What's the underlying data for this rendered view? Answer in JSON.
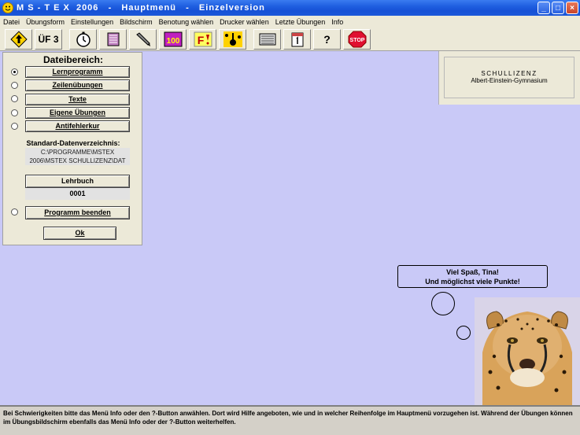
{
  "window": {
    "title": "M S - T E X  2006   -   Hauptmenü   -   Einzelversion",
    "minimize": "_",
    "maximize": "□",
    "close": "×"
  },
  "menu": [
    "Datei",
    "Übungsform",
    "Einstellungen",
    "Bildschirm",
    "Benotung wählen",
    "Drucker wählen",
    "Letzte Übungen",
    "Info"
  ],
  "toolbar": {
    "uf3_label": "ÜF 3",
    "help_label": "?",
    "stop_label": "STOP",
    "counter_label": "100",
    "f_label": "F",
    "icons": [
      "arrow-up-sign-icon",
      "uf3-button",
      "stopwatch-icon",
      "dice-icon",
      "pen-icon",
      "counter-100-icon",
      "f-alert-icon",
      "music-icon",
      "keyboard-icon",
      "calendar-icon",
      "help-icon",
      "stop-icon"
    ]
  },
  "panel": {
    "title": "Dateibereich:",
    "buttons": [
      "Lernprogramm",
      "Zeilenübungen",
      "Texte",
      "Eigene Übungen",
      "Antifehlerkur"
    ],
    "path_label": "Standard-Datenverzeichnis:",
    "path_line1": "C:\\PROGRAMME\\MSTEX",
    "path_line2": "2006\\MSTEX SCHULLIZENZ\\DAT",
    "lehrbuch_label": "Lehrbuch",
    "lehrbuch_value": "0001",
    "quit_label": "Programm beenden",
    "ok_label": "Ok"
  },
  "license": {
    "line1": "SCHULLIZENZ",
    "line2": "Albert-Einstein-Gymnasium"
  },
  "bubble": {
    "line1": "Viel Spaß, Tina!",
    "line2": "Und möglichst viele Punkte!"
  },
  "status": {
    "text": "Bei Schwierigkeiten bitte das Menü Info oder den ?-Button anwählen. Dort wird Hilfe angeboten, wie und in welcher Reihenfolge im Hauptmenü vorzugehen ist. Während der Übungen können im Übungsbildschirm ebenfalls das Menü Info oder der ?-Button weiterhelfen."
  },
  "colors": {
    "workspace": "#c9c9f7",
    "titlebar": "#1f5ee0",
    "panel": "#ece9d8"
  }
}
